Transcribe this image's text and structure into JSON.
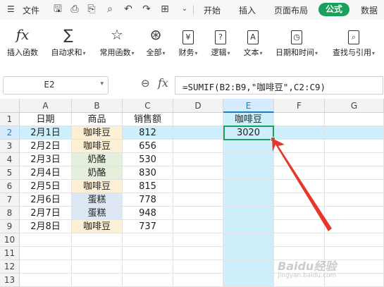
{
  "menubar": {
    "file_label": "文件",
    "tabs": [
      "开始",
      "插入",
      "页面布局",
      "公式",
      "数据"
    ],
    "active_tab": "公式",
    "accent_color": "#1aa05a"
  },
  "ribbon": {
    "buttons": [
      {
        "label": "插入函数",
        "icon": "fx-icon",
        "dropdown": false
      },
      {
        "label": "自动求和",
        "icon": "sigma-icon",
        "dropdown": true
      },
      {
        "label": "常用函数",
        "icon": "star-icon",
        "dropdown": true
      },
      {
        "label": "全部",
        "icon": "asterisk-icon",
        "dropdown": true
      },
      {
        "label": "财务",
        "icon": "finance-icon",
        "dropdown": true
      },
      {
        "label": "逻辑",
        "icon": "logic-icon",
        "dropdown": true
      },
      {
        "label": "文本",
        "icon": "text-icon",
        "dropdown": true
      },
      {
        "label": "日期和时间",
        "icon": "datetime-icon",
        "dropdown": true
      },
      {
        "label": "查找与引用",
        "icon": "lookup-icon",
        "dropdown": true
      }
    ]
  },
  "formula_bar": {
    "cell_ref": "E2",
    "fx_label": "fx",
    "formula": "=SUMIF(B2:B9,\"咖啡豆\",C2:C9)"
  },
  "sheet": {
    "columns": [
      "A",
      "B",
      "C",
      "D",
      "E",
      "F",
      "G"
    ],
    "selected_column": "E",
    "selected_row": "2",
    "row_numbers": [
      "1",
      "2",
      "3",
      "4",
      "5",
      "6",
      "7",
      "8",
      "9",
      "10",
      "11",
      "12",
      "13"
    ],
    "headers": {
      "A": "日期",
      "B": "商品",
      "C": "销售额",
      "E": "咖啡豆"
    },
    "rows": [
      {
        "date": "2月1日",
        "product": "咖啡豆",
        "sales": "812"
      },
      {
        "date": "2月2日",
        "product": "咖啡豆",
        "sales": "656"
      },
      {
        "date": "2月3日",
        "product": "奶酪",
        "sales": "530"
      },
      {
        "date": "2月4日",
        "product": "奶酪",
        "sales": "830"
      },
      {
        "date": "2月5日",
        "product": "咖啡豆",
        "sales": "815"
      },
      {
        "date": "2月6日",
        "product": "蛋糕",
        "sales": "778"
      },
      {
        "date": "2月7日",
        "product": "蛋糕",
        "sales": "948"
      },
      {
        "date": "2月8日",
        "product": "咖啡豆",
        "sales": "737"
      }
    ],
    "result_value": "3020",
    "product_colors": {
      "咖啡豆": "#fdf0d5",
      "奶酪": "#e4f0dc",
      "蛋糕": "#dde8f6"
    }
  },
  "watermark": {
    "text": "Baidu经验",
    "sub": "jingyan.baidu.com"
  }
}
